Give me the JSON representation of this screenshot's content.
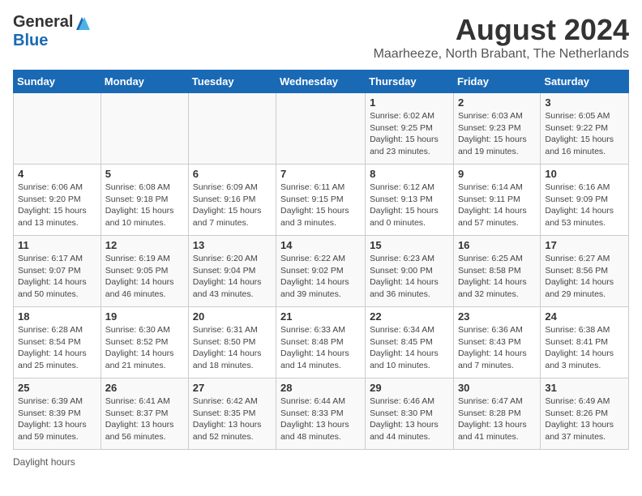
{
  "logo": {
    "general": "General",
    "blue": "Blue"
  },
  "title": "August 2024",
  "subtitle": "Maarheeze, North Brabant, The Netherlands",
  "days_header": [
    "Sunday",
    "Monday",
    "Tuesday",
    "Wednesday",
    "Thursday",
    "Friday",
    "Saturday"
  ],
  "footer": "Daylight hours",
  "weeks": [
    [
      {
        "num": "",
        "info": ""
      },
      {
        "num": "",
        "info": ""
      },
      {
        "num": "",
        "info": ""
      },
      {
        "num": "",
        "info": ""
      },
      {
        "num": "1",
        "info": "Sunrise: 6:02 AM\nSunset: 9:25 PM\nDaylight: 15 hours\nand 23 minutes."
      },
      {
        "num": "2",
        "info": "Sunrise: 6:03 AM\nSunset: 9:23 PM\nDaylight: 15 hours\nand 19 minutes."
      },
      {
        "num": "3",
        "info": "Sunrise: 6:05 AM\nSunset: 9:22 PM\nDaylight: 15 hours\nand 16 minutes."
      }
    ],
    [
      {
        "num": "4",
        "info": "Sunrise: 6:06 AM\nSunset: 9:20 PM\nDaylight: 15 hours\nand 13 minutes."
      },
      {
        "num": "5",
        "info": "Sunrise: 6:08 AM\nSunset: 9:18 PM\nDaylight: 15 hours\nand 10 minutes."
      },
      {
        "num": "6",
        "info": "Sunrise: 6:09 AM\nSunset: 9:16 PM\nDaylight: 15 hours\nand 7 minutes."
      },
      {
        "num": "7",
        "info": "Sunrise: 6:11 AM\nSunset: 9:15 PM\nDaylight: 15 hours\nand 3 minutes."
      },
      {
        "num": "8",
        "info": "Sunrise: 6:12 AM\nSunset: 9:13 PM\nDaylight: 15 hours\nand 0 minutes."
      },
      {
        "num": "9",
        "info": "Sunrise: 6:14 AM\nSunset: 9:11 PM\nDaylight: 14 hours\nand 57 minutes."
      },
      {
        "num": "10",
        "info": "Sunrise: 6:16 AM\nSunset: 9:09 PM\nDaylight: 14 hours\nand 53 minutes."
      }
    ],
    [
      {
        "num": "11",
        "info": "Sunrise: 6:17 AM\nSunset: 9:07 PM\nDaylight: 14 hours\nand 50 minutes."
      },
      {
        "num": "12",
        "info": "Sunrise: 6:19 AM\nSunset: 9:05 PM\nDaylight: 14 hours\nand 46 minutes."
      },
      {
        "num": "13",
        "info": "Sunrise: 6:20 AM\nSunset: 9:04 PM\nDaylight: 14 hours\nand 43 minutes."
      },
      {
        "num": "14",
        "info": "Sunrise: 6:22 AM\nSunset: 9:02 PM\nDaylight: 14 hours\nand 39 minutes."
      },
      {
        "num": "15",
        "info": "Sunrise: 6:23 AM\nSunset: 9:00 PM\nDaylight: 14 hours\nand 36 minutes."
      },
      {
        "num": "16",
        "info": "Sunrise: 6:25 AM\nSunset: 8:58 PM\nDaylight: 14 hours\nand 32 minutes."
      },
      {
        "num": "17",
        "info": "Sunrise: 6:27 AM\nSunset: 8:56 PM\nDaylight: 14 hours\nand 29 minutes."
      }
    ],
    [
      {
        "num": "18",
        "info": "Sunrise: 6:28 AM\nSunset: 8:54 PM\nDaylight: 14 hours\nand 25 minutes."
      },
      {
        "num": "19",
        "info": "Sunrise: 6:30 AM\nSunset: 8:52 PM\nDaylight: 14 hours\nand 21 minutes."
      },
      {
        "num": "20",
        "info": "Sunrise: 6:31 AM\nSunset: 8:50 PM\nDaylight: 14 hours\nand 18 minutes."
      },
      {
        "num": "21",
        "info": "Sunrise: 6:33 AM\nSunset: 8:48 PM\nDaylight: 14 hours\nand 14 minutes."
      },
      {
        "num": "22",
        "info": "Sunrise: 6:34 AM\nSunset: 8:45 PM\nDaylight: 14 hours\nand 10 minutes."
      },
      {
        "num": "23",
        "info": "Sunrise: 6:36 AM\nSunset: 8:43 PM\nDaylight: 14 hours\nand 7 minutes."
      },
      {
        "num": "24",
        "info": "Sunrise: 6:38 AM\nSunset: 8:41 PM\nDaylight: 14 hours\nand 3 minutes."
      }
    ],
    [
      {
        "num": "25",
        "info": "Sunrise: 6:39 AM\nSunset: 8:39 PM\nDaylight: 13 hours\nand 59 minutes."
      },
      {
        "num": "26",
        "info": "Sunrise: 6:41 AM\nSunset: 8:37 PM\nDaylight: 13 hours\nand 56 minutes."
      },
      {
        "num": "27",
        "info": "Sunrise: 6:42 AM\nSunset: 8:35 PM\nDaylight: 13 hours\nand 52 minutes."
      },
      {
        "num": "28",
        "info": "Sunrise: 6:44 AM\nSunset: 8:33 PM\nDaylight: 13 hours\nand 48 minutes."
      },
      {
        "num": "29",
        "info": "Sunrise: 6:46 AM\nSunset: 8:30 PM\nDaylight: 13 hours\nand 44 minutes."
      },
      {
        "num": "30",
        "info": "Sunrise: 6:47 AM\nSunset: 8:28 PM\nDaylight: 13 hours\nand 41 minutes."
      },
      {
        "num": "31",
        "info": "Sunrise: 6:49 AM\nSunset: 8:26 PM\nDaylight: 13 hours\nand 37 minutes."
      }
    ]
  ]
}
